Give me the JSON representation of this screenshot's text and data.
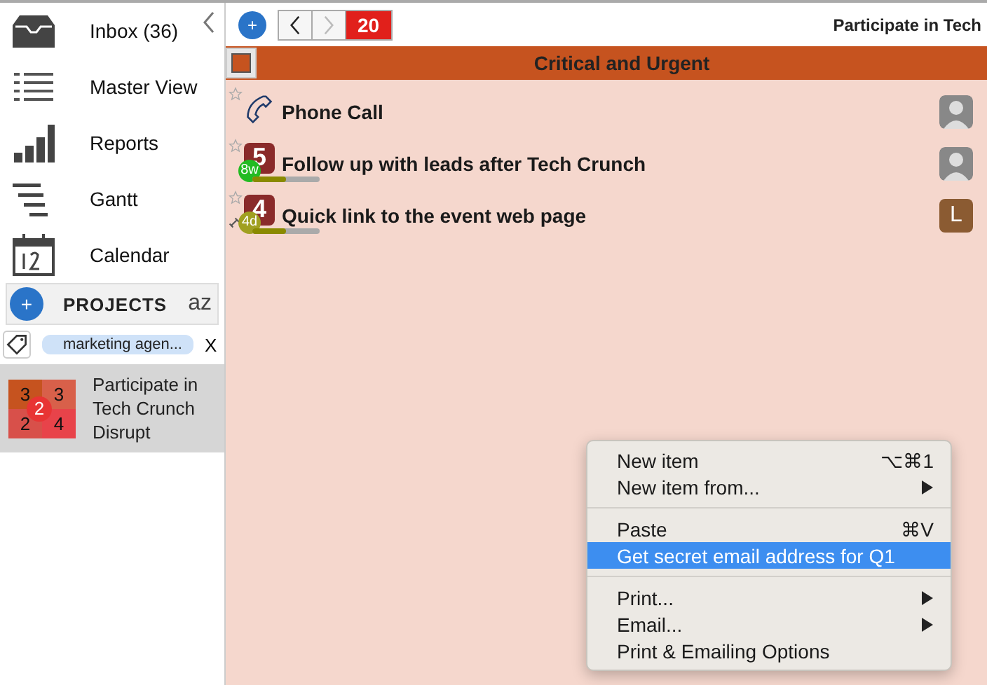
{
  "sidebar": {
    "nav": [
      {
        "kind": "inbox",
        "label": "Inbox (36)"
      },
      {
        "kind": "list",
        "label": "Master View"
      },
      {
        "kind": "reports",
        "label": "Reports"
      },
      {
        "kind": "gantt",
        "label": "Gantt"
      },
      {
        "kind": "calendar",
        "label": "Calendar"
      }
    ],
    "projects_header": {
      "add": "+",
      "label": "PROJECTS",
      "sort": "az"
    },
    "tag_filter": {
      "value": "marketing agen...",
      "clear": "X"
    },
    "projects": [
      {
        "name": "Participate in Tech Crunch Disrupt",
        "grid": [
          "3",
          "3",
          "2",
          "4"
        ],
        "badge": "2",
        "selected": true
      }
    ]
  },
  "toolbar": {
    "add": "+",
    "back_disabled": false,
    "forward_disabled": true,
    "count": "20",
    "title": "Participate in Tech"
  },
  "section": {
    "title": "Critical and Urgent",
    "color": "#c6531f"
  },
  "tasks": [
    {
      "kind": "phone",
      "title": "Phone Call",
      "starred": false,
      "avatar": {
        "kind": "photo"
      },
      "link": false
    },
    {
      "kind": "numbered",
      "number": "5",
      "due": "8w",
      "color": "#22bb22",
      "level": 0.5,
      "title": "Follow up with leads after Tech Crunch",
      "starred": false,
      "avatar": {
        "kind": "photo"
      },
      "link": false
    },
    {
      "kind": "numbered",
      "number": "4",
      "due": "4d",
      "color": "#a0a020",
      "level": 0.5,
      "title": "Quick link to the event web page",
      "starred": false,
      "avatar": {
        "kind": "letter",
        "letter": "L"
      },
      "link": true
    }
  ],
  "context_menu": [
    [
      {
        "label": "New item",
        "shortcut": "⌥⌘1",
        "submenu": false,
        "selected": false
      },
      {
        "label": "New item from...",
        "submenu": true,
        "selected": false
      }
    ],
    [
      {
        "label": "Paste",
        "shortcut": "⌘V",
        "submenu": false,
        "selected": false
      },
      {
        "label": "Get secret email address for Q1",
        "submenu": false,
        "selected": true
      }
    ],
    [
      {
        "label": "Print...",
        "submenu": true,
        "selected": false
      },
      {
        "label": "Email...",
        "submenu": true,
        "selected": false
      },
      {
        "label": "Print & Emailing Options",
        "submenu": false,
        "selected": false
      }
    ]
  ]
}
